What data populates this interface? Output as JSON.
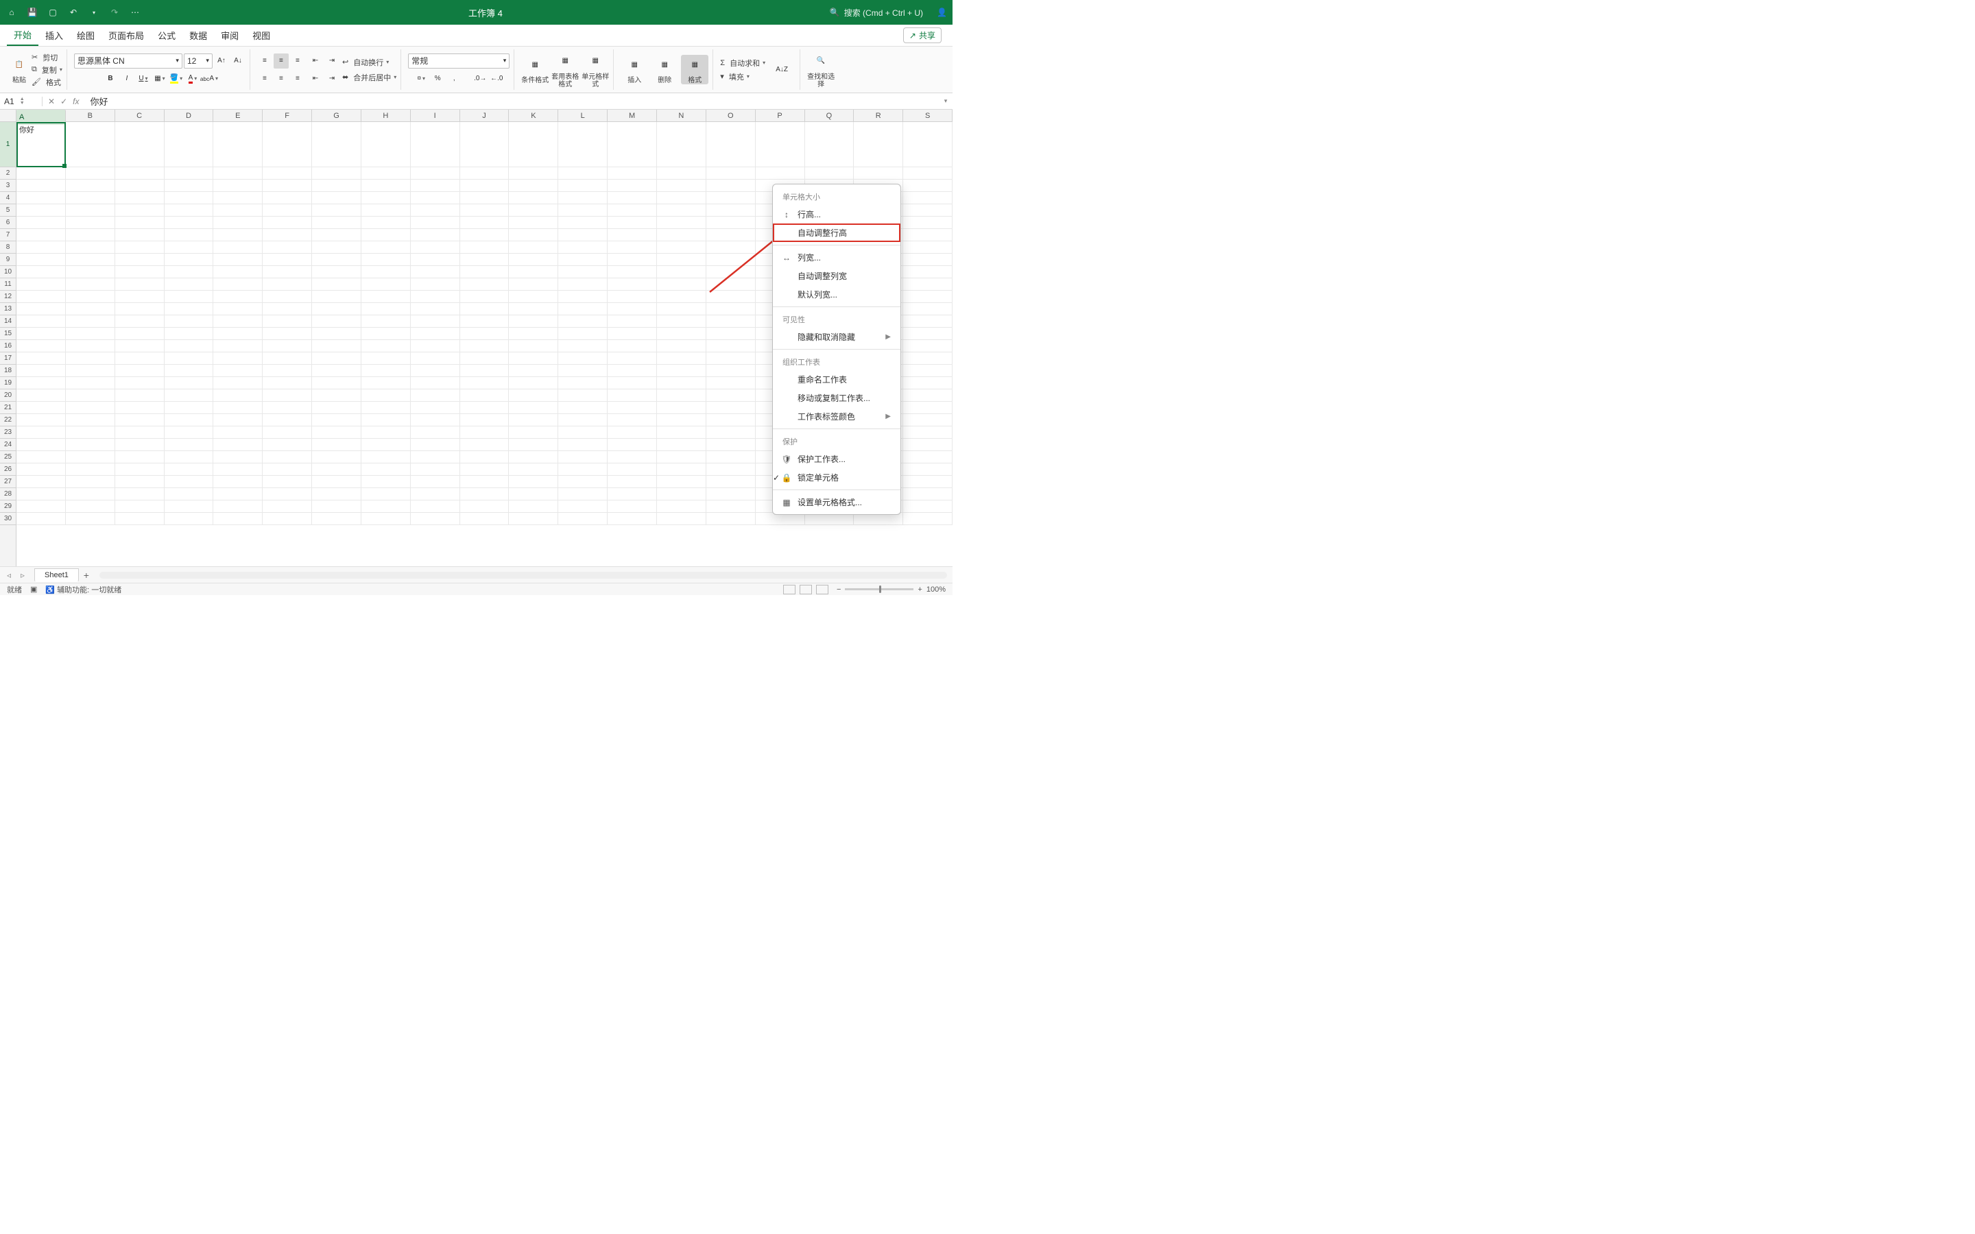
{
  "title": "工作簿 4",
  "search_placeholder": "搜索 (Cmd + Ctrl + U)",
  "tabs": [
    "开始",
    "插入",
    "绘图",
    "页面布局",
    "公式",
    "数据",
    "审阅",
    "视图"
  ],
  "active_tab": 0,
  "share_label": "共享",
  "clipboard": {
    "paste": "粘贴",
    "cut": "剪切",
    "copy": "复制",
    "format": "格式"
  },
  "font": {
    "name": "思源黑体 CN",
    "size": "12"
  },
  "alignment": {
    "wrap": "自动换行",
    "merge": "合并后居中"
  },
  "number_format": "常规",
  "styles": {
    "cond": "条件格式",
    "table": "套用表格格式",
    "cell": "单元格样式"
  },
  "cells_group": {
    "insert": "插入",
    "delete": "删除",
    "format": "格式"
  },
  "editing": {
    "sum": "自动求和",
    "fill": "填充",
    "find": "查找和选择"
  },
  "namebox": "A1",
  "formula": "你好",
  "columns": [
    "A",
    "B",
    "C",
    "D",
    "E",
    "F",
    "G",
    "H",
    "I",
    "J",
    "K",
    "L",
    "M",
    "N",
    "O",
    "P",
    "Q",
    "R",
    "S"
  ],
  "row_count": 30,
  "cell_a1": "你好",
  "sheet_name": "Sheet1",
  "status_ready": "就绪",
  "status_a11y": "辅助功能: 一切就绪",
  "zoom": "100%",
  "menu": {
    "sec1": "单元格大小",
    "row_height": "行高...",
    "auto_row_height": "自动调整行高",
    "col_width": "列宽...",
    "auto_col_width": "自动调整列宽",
    "default_col_width": "默认列宽...",
    "sec2": "可见性",
    "hide_unhide": "隐藏和取消隐藏",
    "sec3": "组织工作表",
    "rename": "重命名工作表",
    "move_copy": "移动或复制工作表...",
    "tab_color": "工作表标签颜色",
    "sec4": "保护",
    "protect_sheet": "保护工作表...",
    "lock_cell": "锁定单元格",
    "format_cells": "设置单元格格式..."
  }
}
